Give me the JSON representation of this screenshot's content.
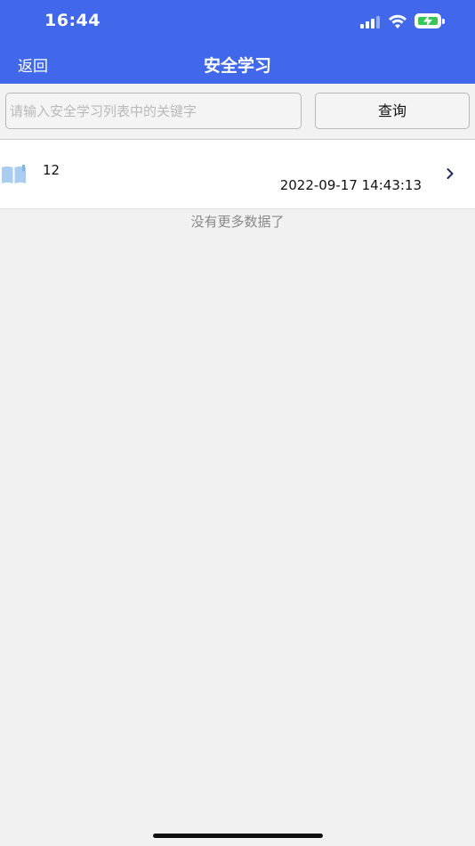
{
  "status_bar": {
    "time": "16:44",
    "signal_icon": "cellular-signal-icon",
    "wifi_icon": "wifi-icon",
    "battery_icon": "battery-charging-icon",
    "battery_color": "#35c759"
  },
  "nav": {
    "back_label": "返回",
    "title": "安全学习",
    "background": "#4168ea"
  },
  "search": {
    "placeholder": "请输入安全学习列表中的关键字",
    "value": "",
    "button_label": "查询"
  },
  "list": {
    "items": [
      {
        "icon": "book-icon",
        "title": "12",
        "time": "2022-09-17 14:43:13",
        "chevron": "chevron-right-icon"
      }
    ],
    "footer": "没有更多数据了"
  }
}
